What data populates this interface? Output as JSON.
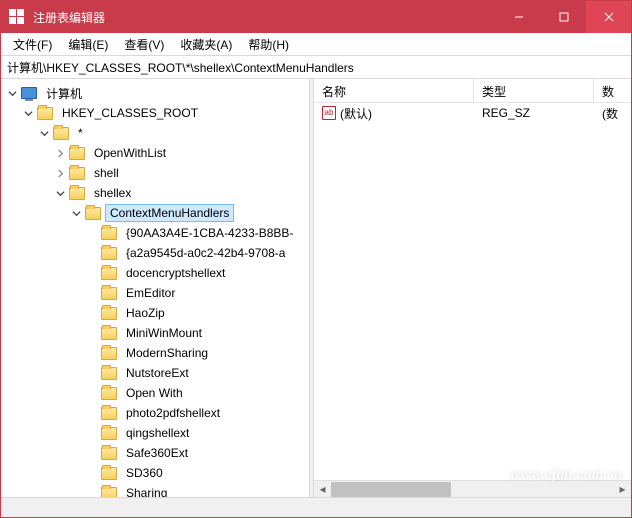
{
  "window": {
    "title": "注册表编辑器"
  },
  "menu": {
    "file": "文件(F)",
    "edit": "编辑(E)",
    "view": "查看(V)",
    "fav": "收藏夹(A)",
    "help": "帮助(H)"
  },
  "address": "计算机\\HKEY_CLASSES_ROOT\\*\\shellex\\ContextMenuHandlers",
  "tree": {
    "root": "计算机",
    "hkcr": "HKEY_CLASSES_ROOT",
    "star": "*",
    "openwithlist": "OpenWithList",
    "shell": "shell",
    "shellex": "shellex",
    "cmh": "ContextMenuHandlers",
    "children": [
      "{90AA3A4E-1CBA-4233-B8BB-",
      "{a2a9545d-a0c2-42b4-9708-a",
      "docencryptshellext",
      "EmEditor",
      "HaoZip",
      "MiniWinMount",
      "ModernSharing",
      "NutstoreExt",
      "Open With",
      "photo2pdfshellext",
      "qingshellext",
      "Safe360Ext",
      "SD360",
      "Sharing"
    ]
  },
  "list": {
    "columns": {
      "name": "名称",
      "type": "类型",
      "data": "数"
    },
    "rows": [
      {
        "name": "(默认)",
        "type": "REG_SZ",
        "data": "(数"
      }
    ]
  },
  "watermark": "www.cfan.com.cn"
}
